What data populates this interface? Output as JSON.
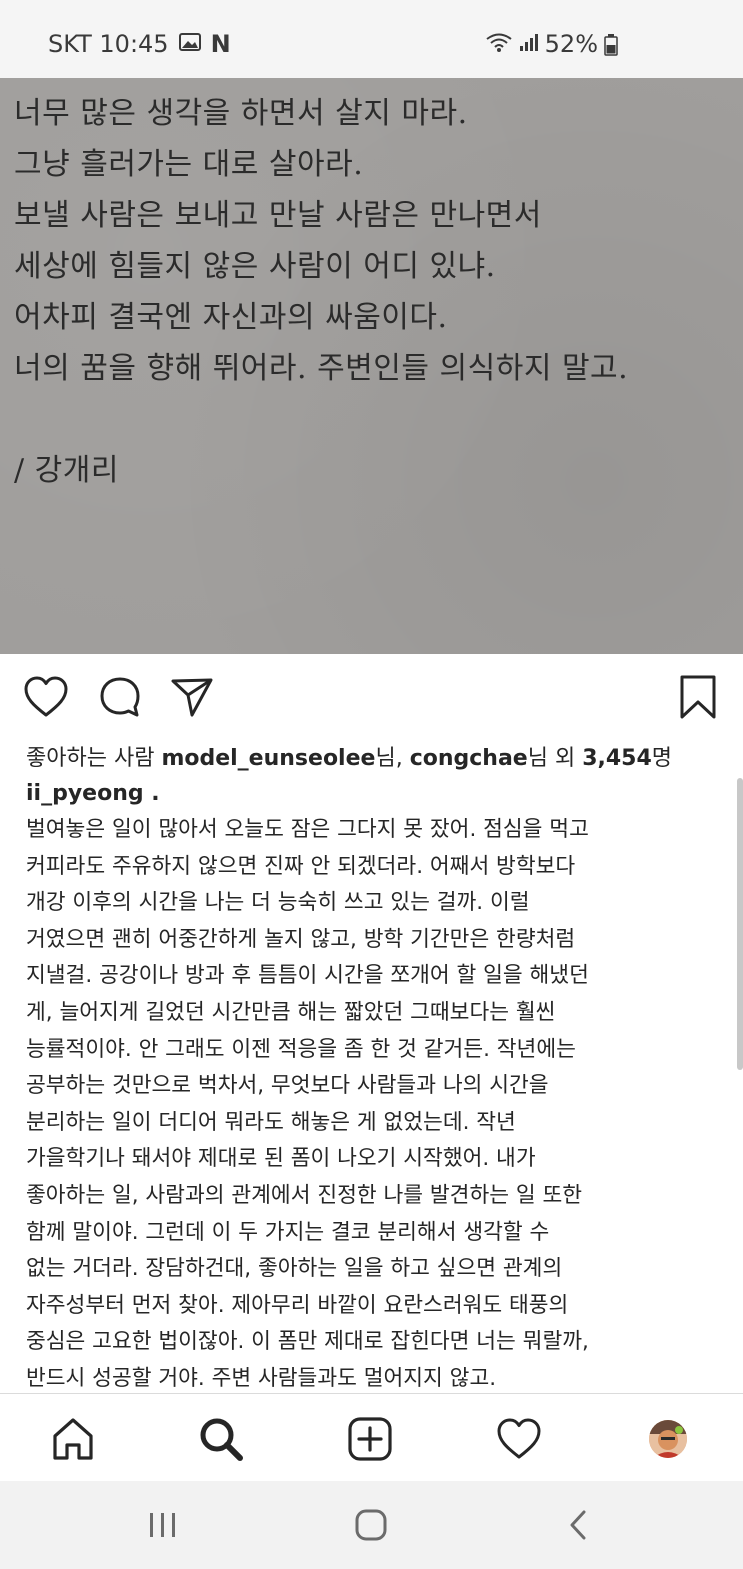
{
  "status_bar": {
    "carrier_time": "SKT 10:45",
    "n_badge": "N",
    "battery": "52%",
    "icons": [
      "gallery-icon",
      "n-notification-icon",
      "wifi-icon",
      "signal-icon",
      "battery-icon"
    ]
  },
  "post_image": {
    "lines": [
      "너무 많은 생각을 하면서 살지 마라.",
      "그냥 흘러가는 대로 살아라.",
      "보낼 사람은 보내고 만날 사람은 만나면서",
      "세상에 힘들지 않은 사람이 어디 있냐.",
      "어차피 결국엔 자신과의 싸움이다.",
      "너의 꿈을 향해 뛰어라. 주변인들 의식하지 말고."
    ],
    "signature": "/ 강개리",
    "background": "#a09e9c"
  },
  "actions": {
    "icons": [
      "heart-icon",
      "comment-icon",
      "share-icon",
      "bookmark-icon"
    ]
  },
  "likes": {
    "prefix": "좋아하는 사람 ",
    "user1": "model_eunseolee",
    "suffix1": "님, ",
    "user2": "congchae",
    "suffix2": "님 외 ",
    "count": "3,454",
    "suffix3": "명"
  },
  "author": "ii_pyeong .",
  "caption_lines": [
    "벌여놓은 일이 많아서 오늘도 잠은 그다지 못 잤어. 점심을 먹고",
    "커피라도 주유하지 않으면 진짜 안 되겠더라. 어째서 방학보다",
    "개강 이후의 시간을 나는 더 능숙히 쓰고 있는 걸까. 이럴",
    "거였으면 괜히 어중간하게 놀지 않고, 방학 기간만은 한량처럼",
    "지낼걸. 공강이나 방과 후 틈틈이 시간을 쪼개어 할 일을 해냈던",
    "게, 늘어지게 길었던 시간만큼 해는 짧았던 그때보다는 훨씬",
    "능률적이야. 안 그래도 이젠 적응을 좀 한 것 같거든. 작년에는",
    "공부하는 것만으로 벅차서, 무엇보다 사람들과 나의 시간을",
    "분리하는 일이 더디어 뭐라도 해놓은 게 없었는데. 작년",
    "가을학기나 돼서야 제대로 된 폼이 나오기 시작했어. 내가",
    "좋아하는 일, 사람과의 관계에서 진정한 나를 발견하는 일 또한",
    "함께 말이야. 그런데 이 두 가지는 결코 분리해서 생각할 수",
    "없는 거더라. 장담하건대, 좋아하는 일을 하고 싶으면 관계의",
    "자주성부터 먼저 찾아. 제아무리 바깥이 요란스러워도 태풍의",
    "중심은 고요한 법이잖아. 이 폼만 제대로 잡힌다면 너는 뭐랄까,",
    "반드시 성공할 거야. 주변 사람들과도 멀어지지 않고."
  ],
  "bottom_nav": {
    "icons": [
      "home-icon",
      "search-icon",
      "add-post-icon",
      "activity-heart-icon",
      "profile-avatar"
    ]
  },
  "system_nav": {
    "icons": [
      "recents-icon",
      "home-button-icon",
      "back-icon"
    ]
  },
  "colors": {
    "text": "#262626",
    "poem_text": "#2b2b2b",
    "status_bg": "#f5f5f5",
    "system_nav_bg": "#f2f2f2"
  }
}
